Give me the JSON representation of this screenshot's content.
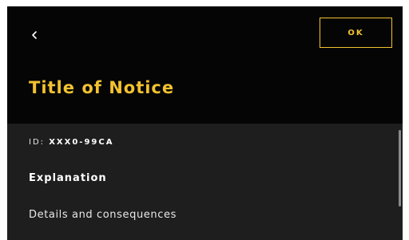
{
  "header": {
    "back_icon": "chevron-left-icon",
    "ok_label": "OK",
    "title": "Title of Notice"
  },
  "notice": {
    "id_label": "ID:",
    "id_value": "XXX0-99CA",
    "explanation_heading": "Explanation",
    "details_text": "Details and consequences"
  },
  "colors": {
    "accent": "#f2c230",
    "header_bg": "#050505",
    "body_bg": "#1e1e1e",
    "text": "#ffffff"
  }
}
